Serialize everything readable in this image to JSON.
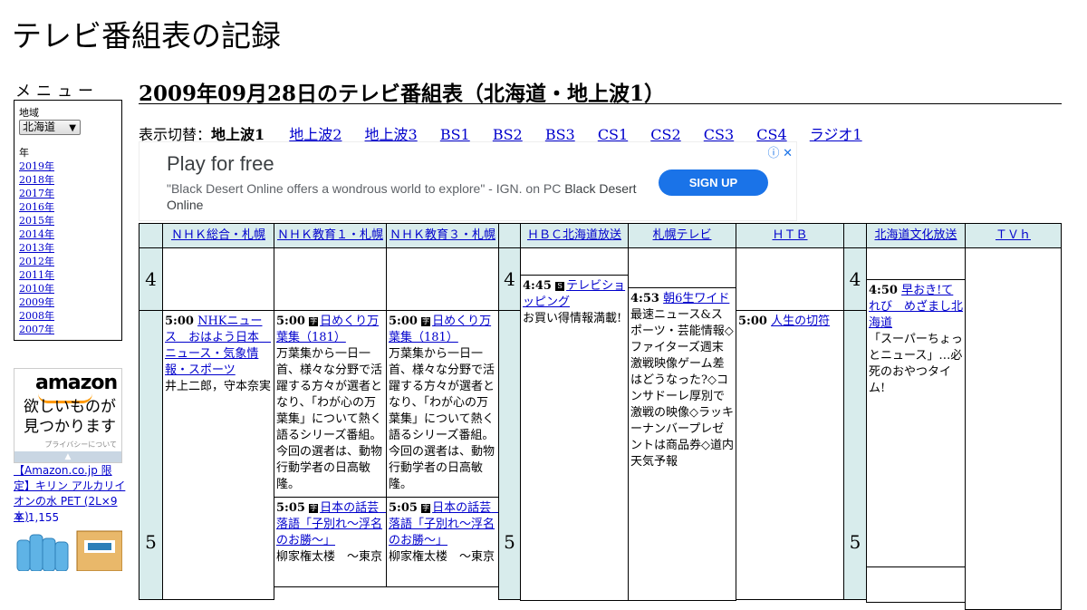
{
  "site": {
    "title": "テレビ番組表の記録"
  },
  "sidebar": {
    "menu_label": "メニュー",
    "region_caption": "地域",
    "region_value": "北海道",
    "year_caption": "年",
    "years": [
      "2019年",
      "2018年",
      "2017年",
      "2016年",
      "2015年",
      "2014年",
      "2013年",
      "2012年",
      "2011年",
      "2010年",
      "2009年",
      "2008年",
      "2007年"
    ]
  },
  "amazon_ad": {
    "logo": "amazon",
    "message_line1": "欲しいものが",
    "message_line2": "見つかります",
    "privacy": "プライバシーについて",
    "product_title": "【Amazon.co.jp 限定】キリン アルカリイオンの水 PET (2L×9本)",
    "product_price": "￥ 1,155"
  },
  "main": {
    "heading": "2009年09月28日のテレビ番組表（北海道・地上波1）",
    "switch_label": "表示切替：",
    "switch_current": "地上波1",
    "switch_links": [
      "地上波2",
      "地上波3",
      "BS1",
      "BS2",
      "BS3",
      "CS1",
      "CS2",
      "CS3",
      "CS4",
      "ラジオ1"
    ]
  },
  "display_ad": {
    "headline": "Play for free",
    "quote": "\"Black Desert Online offers a wondrous world to explore\" - IGN. on PC",
    "brand": "Black Desert Online",
    "cta": "SIGN UP",
    "icons": "ⓘ ✕"
  },
  "grid": {
    "channels": [
      "ＮＨＫ総合・札幌",
      "ＮＨＫ教育１・札幌",
      "ＮＨＫ教育３・札幌",
      "ＨＢＣ北海道放送",
      "札幌テレビ",
      "ＨＴＢ",
      "北海道文化放送",
      "ＴＶｈ"
    ],
    "hours": [
      "4",
      "5"
    ],
    "programs": [
      {
        "time": "5:00",
        "title": "NHKニュース　おはよう日本　ニュース・気象情報・スポーツ",
        "desc": "井上二郎，守本奈実",
        "icon": ""
      },
      {
        "time": "5:00",
        "title": "日めくり万葉集（181）",
        "desc": "万葉集から一日一首、様々な分野で活躍する方々が選者となり、「わが心の万葉集」について熱く語るシリーズ番組。今回の選者は、動物行動学者の日高敏隆。",
        "icon": "字"
      },
      {
        "time": "5:00",
        "title": "日めくり万葉集（181）",
        "desc": "万葉集から一日一首、様々な分野で活躍する方々が選者となり、「わが心の万葉集」について熱く語るシリーズ番組。今回の選者は、動物行動学者の日高敏隆。",
        "icon": "字"
      },
      {
        "time": "5:05",
        "title": "日本の話芸　落語「子別れ～浮名のお勝～」",
        "desc": "柳家権太楼　～東京",
        "icon": "字"
      },
      {
        "time": "5:05",
        "title": "日本の話芸　落語「子別れ～浮名のお勝～」",
        "desc": "柳家権太楼　～東京",
        "icon": "字"
      },
      {
        "time": "4:45",
        "title": "テレビショッピング",
        "desc": "お買い得情報満載!",
        "icon": "S"
      },
      {
        "time": "4:53",
        "title": "朝6生ワイド",
        "desc": "最速ニュース&スポーツ・芸能情報◇ファイターズ週末激戦映像ゲーム差はどうなった?◇コンサドーレ厚別で激戦の映像◇ラッキーナンバープレゼントは商品券◇道内天気予報",
        "icon": ""
      },
      {
        "time": "5:00",
        "title": "人生の切符",
        "desc": "",
        "icon": ""
      },
      {
        "time": "4:50",
        "title": "早おき!てれび　めざまし北海道",
        "desc": "「スーパーちょっとニュース」…必死のおやつタイム!",
        "icon": ""
      }
    ]
  }
}
